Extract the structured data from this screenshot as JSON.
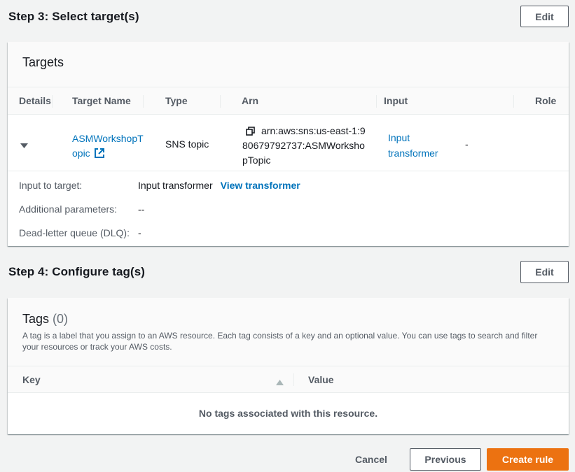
{
  "step3": {
    "title": "Step 3: Select target(s)",
    "edit_label": "Edit",
    "targets_card": {
      "title": "Targets",
      "columns": [
        "Details",
        "Target Name",
        "Type",
        "Arn",
        "Input",
        "Role"
      ],
      "row": {
        "target_name_line1": "ASMWorkshopT",
        "target_name_line2": "opic",
        "type": "SNS topic",
        "arn_line1": "arn:aws:sns:us-east-1:9",
        "arn_line2": "80679792737:ASMWorksho",
        "arn_line3": "pTopic",
        "input_line1": "Input",
        "input_line2": "transformer",
        "role": "-"
      },
      "details": {
        "input_to_target_label": "Input to target:",
        "input_to_target_value": "Input transformer",
        "view_transformer_label": "View transformer",
        "additional_parameters_label": "Additional parameters:",
        "additional_parameters_value": "--",
        "dlq_label": "Dead-letter queue (DLQ):",
        "dlq_value": "-"
      }
    }
  },
  "step4": {
    "title": "Step 4: Configure tag(s)",
    "edit_label": "Edit",
    "tags_card": {
      "title": "Tags",
      "count": "(0)",
      "description_line1": "A tag is a label that you assign to an AWS resource. Each tag consists of a key and an optional value. You can use tags to search and filter",
      "description_line2": "your resources or track your AWS costs.",
      "columns": [
        "Key",
        "Value"
      ],
      "empty_text": "No tags associated with this resource."
    }
  },
  "footer": {
    "cancel_label": "Cancel",
    "previous_label": "Previous",
    "create_label": "Create rule"
  },
  "colors": {
    "link": "#0073bb",
    "primary": "#ec7211",
    "background": "#f2f3f3"
  },
  "icons": {
    "expand": "caret-down-icon",
    "external_link": "external-link-icon",
    "copy": "copy-icon",
    "sort": "sort-ascending-icon"
  }
}
